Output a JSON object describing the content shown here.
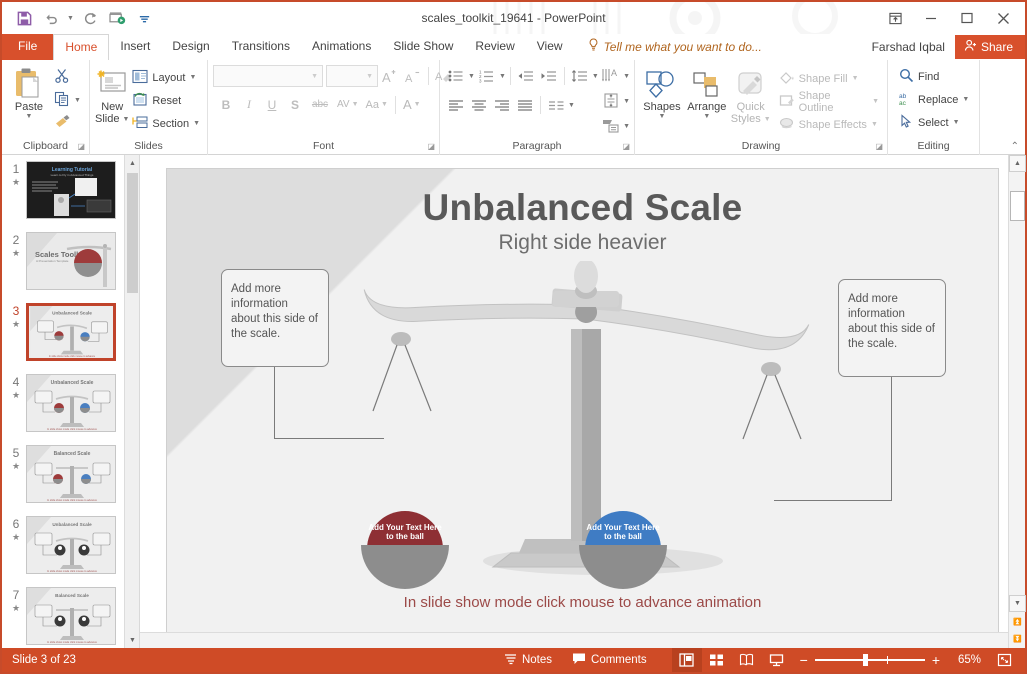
{
  "titlebar": {
    "document_title": "scales_toolkit_19641 - PowerPoint",
    "qat": [
      {
        "name": "save-button",
        "label": "Save"
      },
      {
        "name": "undo-button",
        "label": "Undo"
      },
      {
        "name": "redo-button",
        "label": "Redo"
      },
      {
        "name": "start-presentation-button",
        "label": "Start From Beginning"
      },
      {
        "name": "customize-qat-button",
        "label": "Customize Quick Access Toolbar"
      }
    ],
    "window": {
      "ribbon_display_options": "Ribbon Display Options",
      "minimize": "Minimize",
      "restore": "Restore Down",
      "close": "Close"
    }
  },
  "tabs": {
    "file": "File",
    "items": [
      "Home",
      "Insert",
      "Design",
      "Transitions",
      "Animations",
      "Slide Show",
      "Review",
      "View"
    ],
    "active": "Home",
    "tell_me": "Tell me what you want to do...",
    "user_name": "Farshad Iqbal",
    "share": "Share"
  },
  "ribbon": {
    "groups": [
      {
        "label": "Clipboard",
        "paste": "Paste",
        "cut": "Cut",
        "copy": "Copy",
        "format_painter": "Format Painter"
      },
      {
        "label": "Slides",
        "new_slide": "New\nSlide",
        "new_slide_l1": "New",
        "new_slide_l2": "Slide",
        "layout": "Layout",
        "reset": "Reset",
        "section": "Section"
      },
      {
        "label": "Font",
        "font_name": "",
        "font_size": "",
        "increase_font": "Increase Font Size",
        "decrease_font": "Decrease Font Size",
        "clear_formatting": "Clear All Formatting",
        "bold": "B",
        "italic": "I",
        "underline": "U",
        "shadow": "S",
        "strikethrough": "abc",
        "character_spacing": "AV",
        "change_case": "Aa",
        "font_color": "A"
      },
      {
        "label": "Paragraph",
        "bullets": "Bullets",
        "numbering": "Numbering",
        "decrease_indent": "Decrease List Level",
        "increase_indent": "Increase List Level",
        "line_spacing": "Line Spacing",
        "text_direction": "Text Direction",
        "align_text": "Align Text",
        "convert_smartart": "Convert to SmartArt",
        "align_left": "Align Left",
        "center": "Center",
        "align_right": "Align Right",
        "justify": "Justify",
        "columns": "Columns"
      },
      {
        "label": "Drawing",
        "shapes": "Shapes",
        "arrange": "Arrange",
        "quick_styles_l1": "Quick",
        "quick_styles_l2": "Styles",
        "shape_fill": "Shape Fill",
        "shape_outline": "Shape Outline",
        "shape_effects": "Shape Effects"
      },
      {
        "label": "Editing",
        "find": "Find",
        "replace": "Replace",
        "select": "Select"
      }
    ],
    "collapse": "Collapse the Ribbon"
  },
  "thumbnails": {
    "selected": 3,
    "items": [
      {
        "number": "1",
        "animated": true,
        "kind": "dark-title"
      },
      {
        "number": "2",
        "animated": true,
        "kind": "cover",
        "title": "Scales Toolkit",
        "sub": "A Presentation Template"
      },
      {
        "number": "3",
        "animated": true,
        "kind": "scale-balls",
        "title": "Unbalanced Scale"
      },
      {
        "number": "4",
        "animated": true,
        "kind": "scale-balls",
        "title": "Unbalanced Scale"
      },
      {
        "number": "5",
        "animated": true,
        "kind": "scale-balls",
        "title": "Balanced Scale"
      },
      {
        "number": "6",
        "animated": true,
        "kind": "scale-people",
        "title": "Unbalanced Scale"
      },
      {
        "number": "7",
        "animated": true,
        "kind": "scale-people",
        "title": "Balanced Scale"
      }
    ]
  },
  "slide": {
    "title": "Unbalanced Scale",
    "subtitle": "Right side heavier",
    "left_callout": "Add more information about this side of the scale.",
    "right_callout": "Add more information about this side of the scale.",
    "left_ball_text": "Add Your Text Here to the ball",
    "right_ball_text": "Add Your Text Here to the ball",
    "note": "In slide show mode click mouse to advance animation",
    "colors": {
      "left_ball": "#8e2f34",
      "right_ball": "#3f7cc4",
      "pan": "#8d8d8d",
      "note_text": "#9c4a48"
    }
  },
  "statusbar": {
    "slide_counter": "Slide 3 of 23",
    "notes": "Notes",
    "comments": "Comments",
    "views": [
      {
        "name": "normal-view-button",
        "label": "Normal",
        "active": true
      },
      {
        "name": "slide-sorter-view-button",
        "label": "Slide Sorter",
        "active": false
      },
      {
        "name": "reading-view-button",
        "label": "Reading View",
        "active": false
      },
      {
        "name": "slide-show-button",
        "label": "Slide Show",
        "active": false
      }
    ],
    "zoom_out": "−",
    "zoom_in": "+",
    "zoom_level": "65%",
    "fit_to_window": "Fit slide to current window",
    "accent": "#cf4b26"
  }
}
